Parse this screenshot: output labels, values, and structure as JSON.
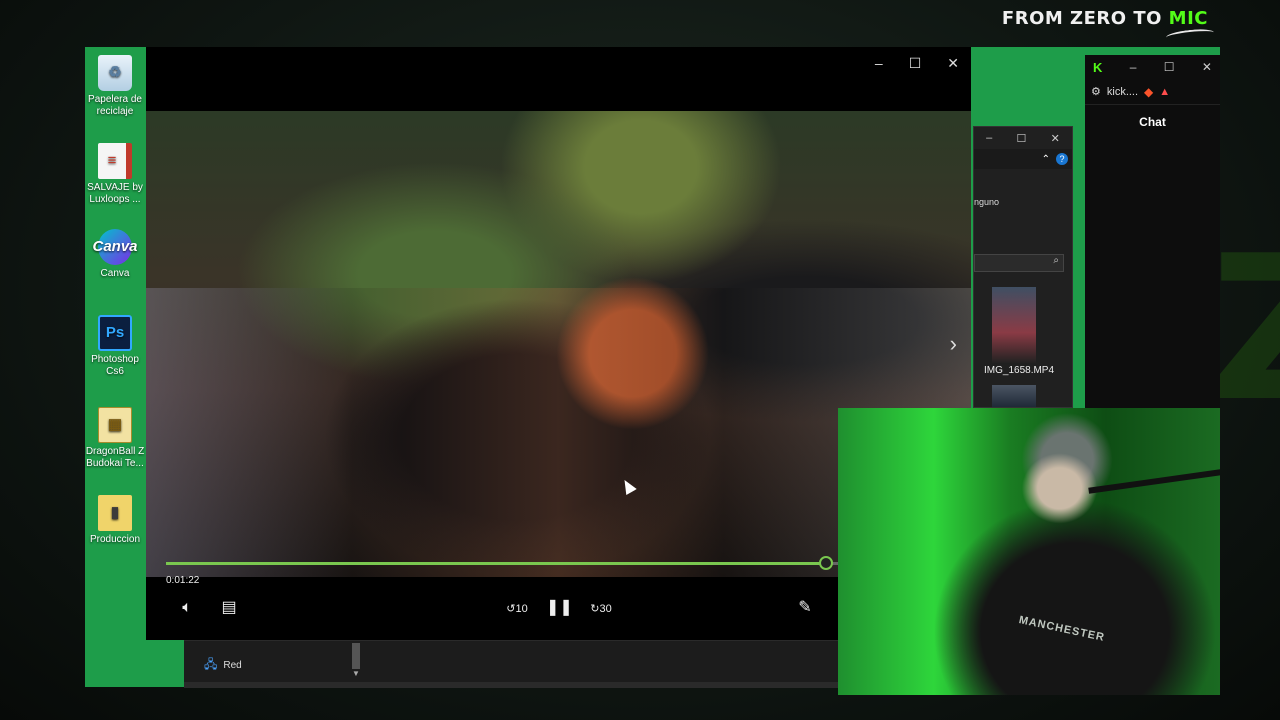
{
  "overlay": {
    "brand_main": "FROM ZERO TO ",
    "brand_accent": "MIC",
    "accent_color": "#53fc18"
  },
  "desktop": {
    "icons": [
      {
        "label": "Papelera de reciclaje",
        "icon": "recycle-bin-icon"
      },
      {
        "label": "SALVAJE by Luxloops ...",
        "icon": "document-icon"
      },
      {
        "label": "Canva",
        "icon": "canva-icon",
        "glyph": "Canva"
      },
      {
        "label": "Photoshop Cs6",
        "icon": "photoshop-icon",
        "glyph": "Ps"
      },
      {
        "label": "DragonBall Z Budokai Te...",
        "icon": "archive-icon"
      },
      {
        "label": "Produccion",
        "icon": "folder-icon"
      }
    ]
  },
  "player": {
    "window_controls": [
      "–",
      "☐",
      "✕"
    ],
    "timecode": "0:01:22",
    "progress": 0.82,
    "progress_color": "#7ac74f",
    "controls": {
      "volume": "volume-icon",
      "subtitles": "subtitles-icon",
      "rewind": "10",
      "pause": "pause-icon",
      "forward": "30",
      "edit": "pencil-icon"
    }
  },
  "explorer": {
    "partial_text": "nguno",
    "file_label": "IMG_1658.MP4"
  },
  "browser": {
    "tab_label": "kick....",
    "chat_title": "Chat"
  },
  "webcam": {
    "hoodie_text": "MANCHESTER"
  },
  "lower_strip": {
    "network_label": "Red"
  }
}
